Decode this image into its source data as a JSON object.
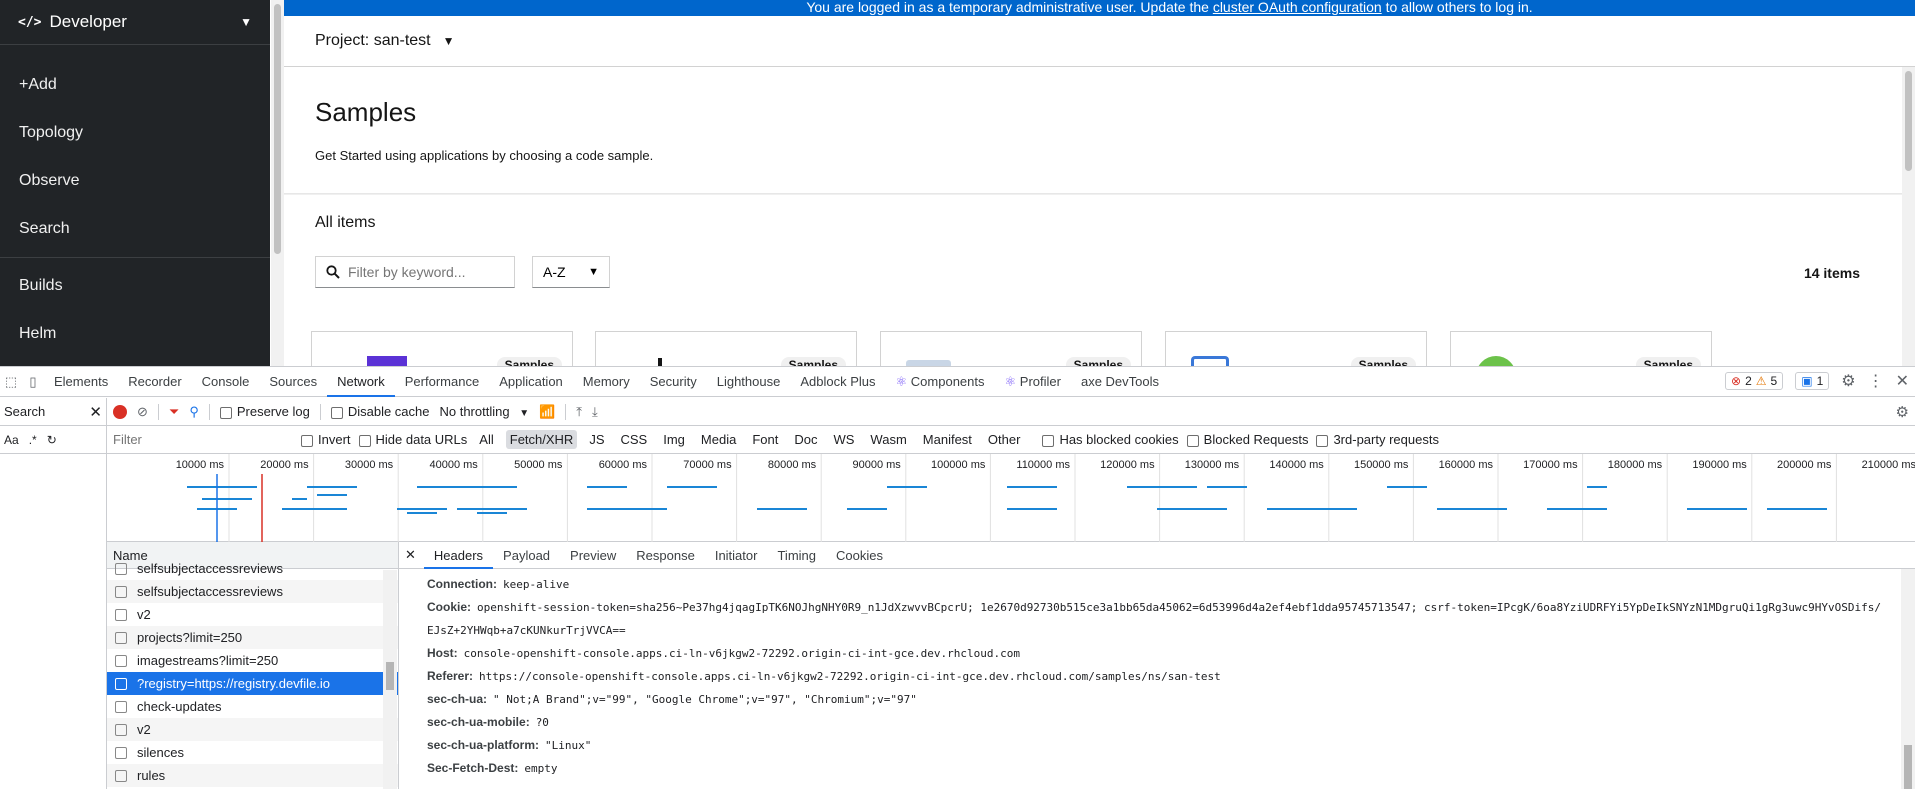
{
  "sidebar": {
    "perspective": "Developer",
    "items": [
      {
        "label": "+Add"
      },
      {
        "label": "Topology"
      },
      {
        "label": "Observe"
      },
      {
        "label": "Search"
      },
      {
        "label": "Builds"
      },
      {
        "label": "Helm"
      }
    ]
  },
  "banner": {
    "text_before": "You are logged in as a temporary administrative user. Update the ",
    "link": "cluster OAuth configuration",
    "text_after": " to allow others to log in."
  },
  "project": {
    "label": "Project: san-test"
  },
  "page": {
    "title": "Samples",
    "description": "Get Started using applications by choosing a code sample."
  },
  "catalog": {
    "heading": "All items",
    "filter_placeholder": "Filter by keyword...",
    "sort_value": "A-Z",
    "count": "14 items",
    "card_badge": "Samples"
  },
  "devtools": {
    "tabs": [
      "Elements",
      "Recorder",
      "Console",
      "Sources",
      "Network",
      "Performance",
      "Application",
      "Memory",
      "Security",
      "Lighthouse",
      "Adblock Plus",
      "Components",
      "Profiler",
      "axe DevTools"
    ],
    "active_tab": "Network",
    "errors": "2",
    "warnings": "5",
    "messages": "1",
    "search_pane_title": "Search",
    "search_opts": [
      "Aa",
      ".*"
    ],
    "toolbar": {
      "preserve_log": "Preserve log",
      "disable_cache": "Disable cache",
      "throttling": "No throttling"
    },
    "filter": {
      "placeholder": "Filter",
      "invert": "Invert",
      "hide_data_urls": "Hide data URLs",
      "types": [
        "All",
        "Fetch/XHR",
        "JS",
        "CSS",
        "Img",
        "Media",
        "Font",
        "Doc",
        "WS",
        "Wasm",
        "Manifest",
        "Other"
      ],
      "active_type": "Fetch/XHR",
      "has_blocked_cookies": "Has blocked cookies",
      "blocked_requests": "Blocked Requests",
      "third_party": "3rd-party requests"
    },
    "timeline_ticks": [
      "10000 ms",
      "20000 ms",
      "30000 ms",
      "40000 ms",
      "50000 ms",
      "60000 ms",
      "70000 ms",
      "80000 ms",
      "90000 ms",
      "100000 ms",
      "110000 ms",
      "120000 ms",
      "130000 ms",
      "140000 ms",
      "150000 ms",
      "160000 ms",
      "170000 ms",
      "180000 ms",
      "190000 ms",
      "200000 ms",
      "210000 ms"
    ],
    "name_header": "Name",
    "requests": [
      {
        "name": "selfsubjectaccessreviews"
      },
      {
        "name": "selfsubjectaccessreviews"
      },
      {
        "name": "v2"
      },
      {
        "name": "projects?limit=250"
      },
      {
        "name": "imagestreams?limit=250"
      },
      {
        "name": "?registry=https://registry.devfile.io",
        "selected": true
      },
      {
        "name": "check-updates"
      },
      {
        "name": "v2"
      },
      {
        "name": "silences"
      },
      {
        "name": "rules"
      }
    ],
    "detail_tabs": [
      "Headers",
      "Payload",
      "Preview",
      "Response",
      "Initiator",
      "Timing",
      "Cookies"
    ],
    "active_detail_tab": "Headers",
    "headers": [
      {
        "key": "Connection:",
        "value": "keep-alive"
      },
      {
        "key": "Cookie:",
        "value": "openshift-session-token=sha256~Pe37hg4jqagIpTK6NOJhgNHY0R9_n1JdXzwvvBCpcrU; 1e2670d92730b515ce3a1bb65da45062=6d53996d4a2ef4ebf1dda95745713547; csrf-token=IPcgK/6oa8YziUDRFYi5YpDeIkSNYzN1MDgruQi1gRg3uwc9HYvOSDifs/EJsZ+2YHWqb+a7cKUNkurTrjVVCA=="
      },
      {
        "key": "Host:",
        "value": "console-openshift-console.apps.ci-ln-v6jkgw2-72292.origin-ci-int-gce.dev.rhcloud.com"
      },
      {
        "key": "Referer:",
        "value": "https://console-openshift-console.apps.ci-ln-v6jkgw2-72292.origin-ci-int-gce.dev.rhcloud.com/samples/ns/san-test"
      },
      {
        "key": "sec-ch-ua:",
        "value": "\" Not;A Brand\";v=\"99\", \"Google Chrome\";v=\"97\", \"Chromium\";v=\"97\""
      },
      {
        "key": "sec-ch-ua-mobile:",
        "value": "?0"
      },
      {
        "key": "sec-ch-ua-platform:",
        "value": "\"Linux\""
      },
      {
        "key": "Sec-Fetch-Dest:",
        "value": "empty"
      }
    ]
  }
}
